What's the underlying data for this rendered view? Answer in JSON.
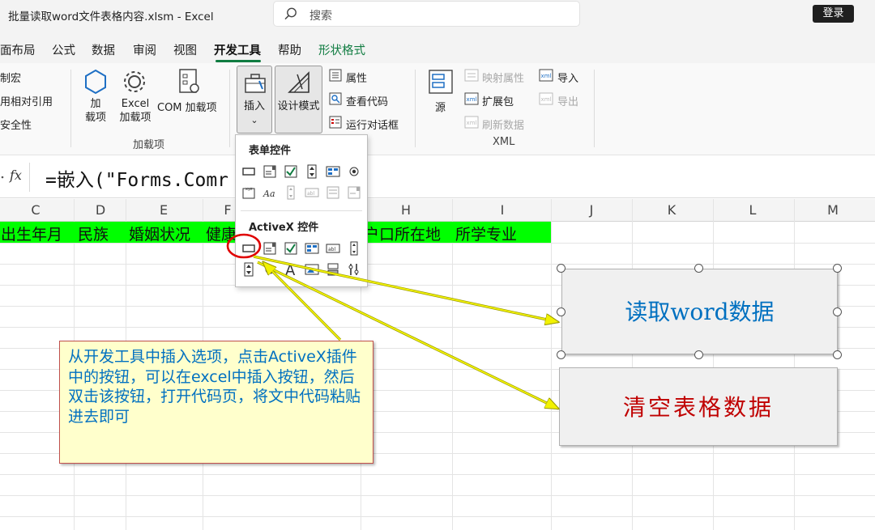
{
  "window": {
    "title": "批量读取word文件表格内容.xlsm  -  Excel",
    "search_placeholder": "搜索",
    "login_label": "登录"
  },
  "menu": {
    "tabs": [
      "面布局",
      "公式",
      "数据",
      "审阅",
      "视图",
      "开发工具",
      "帮助",
      "形状格式"
    ],
    "active_tab": "开发工具"
  },
  "ribbon": {
    "code_items": [
      "制宏",
      "用相对引用",
      "安全性"
    ],
    "addins": {
      "addin_label_line1": "加",
      "addin_label_line2": "载项",
      "excel_addin_line1": "Excel",
      "excel_addin_line2": "加载项",
      "com_addin": "COM 加载项",
      "group_label": "加载项"
    },
    "controls": {
      "insert_label": "插入",
      "design_mode_label": "设计模式",
      "properties_label": "属性",
      "view_code_label": "查看代码",
      "run_dialog_label": "运行对话框"
    },
    "xml": {
      "source_label": "源",
      "map_properties_label": "映射属性",
      "expansion_packs_label": "扩展包",
      "refresh_data_label": "刷新数据",
      "import_label": "导入",
      "export_label": "导出",
      "group_label": "XML"
    }
  },
  "formula_bar": {
    "fx_label": "fx",
    "formula": "=嵌入(\"Forms.Comr            \",\"\")"
  },
  "insert_menu": {
    "form_controls_heading": "表单控件",
    "activex_controls_heading": "ActiveX 控件"
  },
  "sheet": {
    "columns": [
      "C",
      "D",
      "E",
      "F",
      "G",
      "H",
      "I",
      "J",
      "K",
      "L",
      "M"
    ],
    "header_row": [
      "出生年月",
      "民族",
      "婚姻状况",
      "健康",
      "户口所在地",
      "所学专业"
    ]
  },
  "buttons": {
    "read_word": "读取word数据",
    "clear_table": "清空表格数据"
  },
  "callout": {
    "text": "从开发工具中插入选项，点击ActiveX插件中的按钮，可以在excel中插入按钮，然后双击该按钮，打开代码页，将文中代码粘贴进去即可"
  },
  "colors": {
    "accent_green": "#107c41",
    "header_fill": "#00ff00",
    "read_button_text": "#0070c0",
    "clear_button_text": "#c00000",
    "callout_fill": "#ffffcc",
    "annotation_red": "#e00000",
    "arrow_yellow": "#f2f200"
  }
}
